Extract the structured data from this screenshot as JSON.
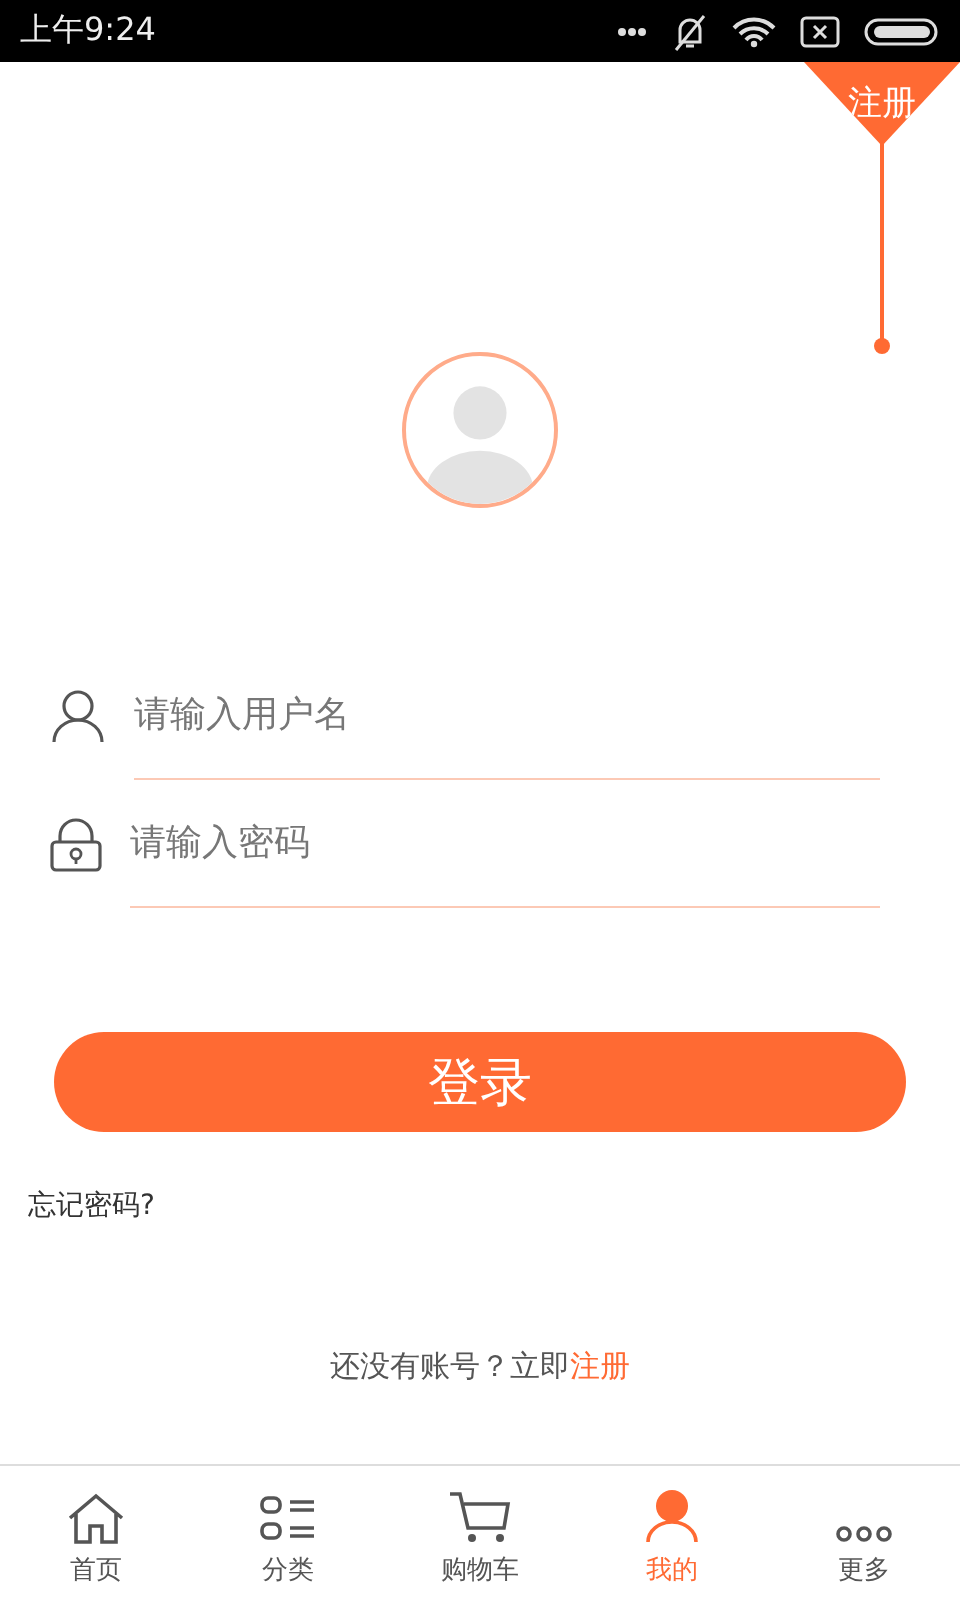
{
  "status_bar": {
    "time": "上午9:24"
  },
  "register_corner": {
    "label": "注册"
  },
  "login_form": {
    "fields": [
      {
        "kind": "user",
        "placeholder": "请输入用户名"
      },
      {
        "kind": "lock",
        "placeholder": "请输入密码"
      }
    ],
    "submit": "登录",
    "forgot_password": "忘记密码?",
    "signup_prompt": "还没有账号？立即",
    "signup_link": "注册"
  },
  "tab_bar": {
    "tabs": [
      {
        "kind": "home",
        "label": "首页",
        "selected": false
      },
      {
        "kind": "list",
        "label": "分类",
        "selected": false
      },
      {
        "kind": "cart",
        "label": "购物车",
        "selected": false
      },
      {
        "kind": "person",
        "label": "我的",
        "selected": true
      },
      {
        "kind": "dots",
        "label": "更多",
        "selected": false
      }
    ]
  }
}
